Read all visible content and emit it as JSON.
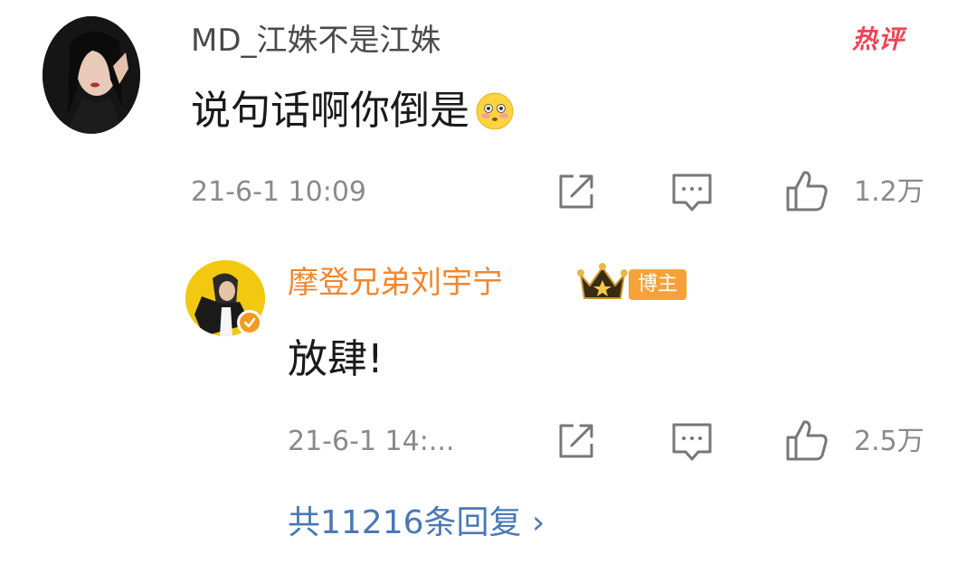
{
  "comment": {
    "username": "MD_江姝不是江姝",
    "hot_label": "热评",
    "text": "说句话啊你倒是",
    "emoji": "flushed-face",
    "time": "21-6-1 10:09",
    "likes": "1.2万"
  },
  "reply": {
    "username": "摩登兄弟刘宇宁",
    "badge": "博主",
    "text": "放肆!",
    "time": "21-6-1 14:...",
    "likes": "2.5万"
  },
  "more_replies": "共11216条回复 ›",
  "colors": {
    "hot": "#ee4456",
    "blogger_name": "#f1862e",
    "blogger_badge": "#f6a13a",
    "link": "#4a78b5",
    "meta": "#8a8a8a"
  }
}
